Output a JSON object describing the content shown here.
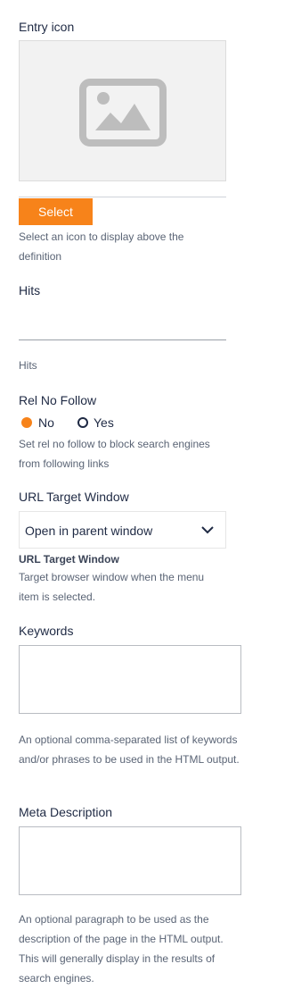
{
  "entry_icon": {
    "label": "Entry icon",
    "select_button": "Select",
    "help": "Select an icon to display above the definition",
    "placeholder_icon": "image-placeholder-icon"
  },
  "hits": {
    "label": "Hits",
    "value": "",
    "help": "Hits"
  },
  "rel_no_follow": {
    "label": "Rel No Follow",
    "options": [
      "No",
      "Yes"
    ],
    "selected": "No",
    "help": "Set rel no follow to block search engines from following links"
  },
  "url_target_window": {
    "label": "URL Target Window",
    "value": "Open in parent window",
    "help_title": "URL Target Window",
    "help": "Target browser window when the menu item is selected."
  },
  "keywords": {
    "label": "Keywords",
    "value": "",
    "help": "An optional comma-separated list of keywords and/or phrases to be used in the HTML output."
  },
  "meta_description": {
    "label": "Meta Description",
    "value": "",
    "help": "An optional paragraph to be used as the description of the page in the HTML output. This will generally display in the results of search engines."
  },
  "colors": {
    "accent": "#f7831a",
    "text": "#1f2a44"
  }
}
